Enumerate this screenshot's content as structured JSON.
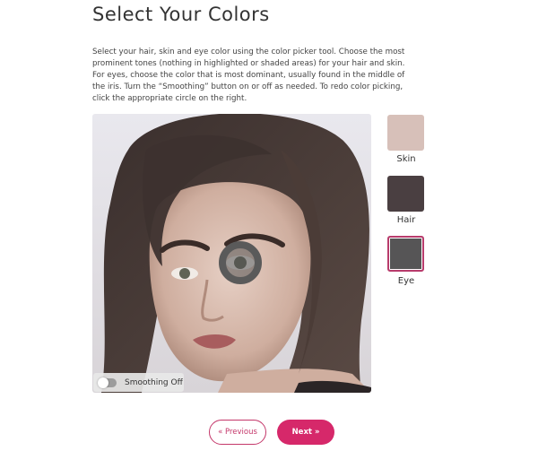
{
  "page": {
    "title": "Select Your Colors",
    "instructions": "Select your hair, skin and eye color using the color picker tool. Choose the most prominent tones (nothing in highlighted or shaded areas) for your hair and skin. For eyes, choose the color that is most dominant, usually found in the middle of the iris. Turn the “Smoothing” button on or off as needed. To redo color picking, click the appropriate circle on the right."
  },
  "smoothing": {
    "label": "Smoothing Off",
    "enabled": false
  },
  "swatches": [
    {
      "label": "Skin",
      "color": "#d7c0b9",
      "selected": false
    },
    {
      "label": "Hair",
      "color": "#4a3f41",
      "selected": false
    },
    {
      "label": "Eye",
      "color": "#565556",
      "selected": true
    }
  ],
  "buttons": {
    "previous": "« Previous",
    "next": "Next »"
  },
  "colors": {
    "accent": "#d6286a",
    "accent_border": "#c4376a"
  }
}
